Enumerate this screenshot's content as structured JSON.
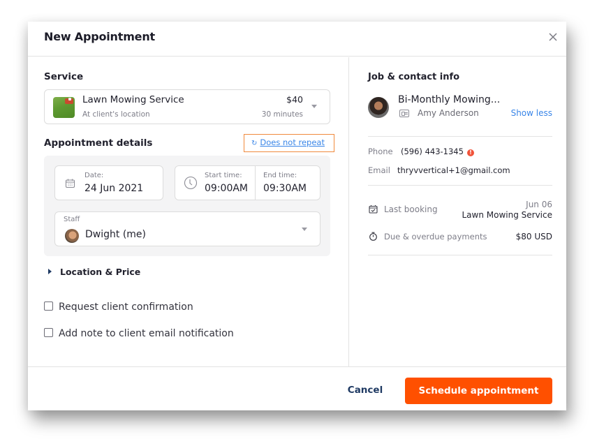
{
  "dialog": {
    "title": "New Appointment",
    "close_label": "×"
  },
  "service": {
    "section_title": "Service",
    "name": "Lawn Mowing Service",
    "location": "At client's location",
    "price": "$40",
    "duration": "30 minutes"
  },
  "details": {
    "section_title": "Appointment details",
    "repeat_label": "Does not repeat",
    "date_label": "Date:",
    "date_value": "24 Jun 2021",
    "start_label": "Start time:",
    "start_value": "09:00AM",
    "end_label": "End time:",
    "end_value": "09:30AM",
    "staff_label": "Staff",
    "staff_value": "Dwight (me)"
  },
  "location_price": {
    "label": "Location & Price"
  },
  "options": [
    {
      "label": "Request client confirmation",
      "checked": false
    },
    {
      "label": "Add note to client email notification",
      "checked": false
    }
  ],
  "footer": {
    "cancel_label": "Cancel",
    "primary_label": "Schedule appointment",
    "primary_color": "#ff5000"
  },
  "contact": {
    "section_title": "Job & contact info",
    "job_name": "Bi-Monthly Mowing...",
    "client_name": "Amy Anderson",
    "toggle_label": "Show less",
    "phone_label": "Phone",
    "phone_value": "(596) 443-1345",
    "phone_alert": "!",
    "email_label": "Email",
    "email_value": "thryvvertical+1@gmail.com",
    "last_booking_label": "Last booking",
    "last_booking_date": "Jun 06",
    "last_booking_service": "Lawn Mowing Service",
    "payments_label": "Due & overdue payments",
    "payments_value": "$80 USD"
  }
}
